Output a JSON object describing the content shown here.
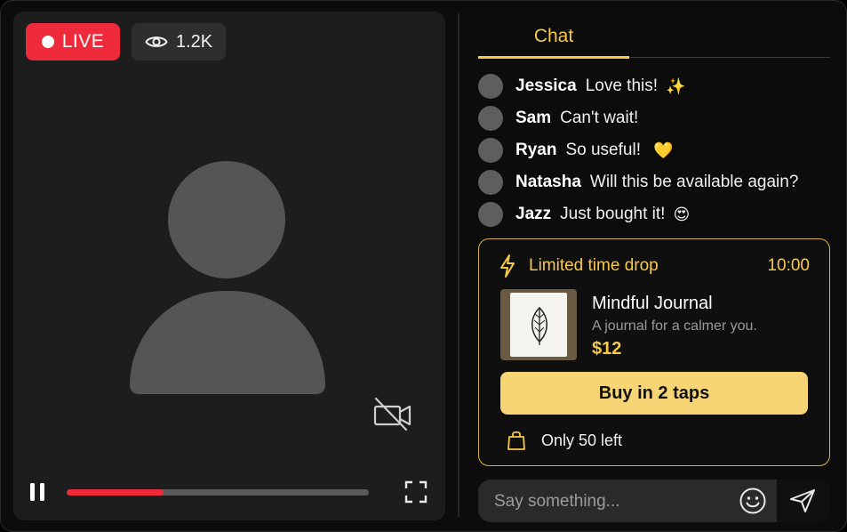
{
  "video": {
    "live_label": "LIVE",
    "viewer_count": "1.2K",
    "playback_progress": 0.32,
    "live_color": "#ee2a3b"
  },
  "chat": {
    "tab_label": "Chat",
    "accent_color": "#f7c948",
    "messages": [
      {
        "user": "Jessica",
        "text": "Love this!",
        "emoji": "✨"
      },
      {
        "user": "Sam",
        "text": "Can't wait!",
        "emoji": ""
      },
      {
        "user": "Ryan",
        "text": "So useful!",
        "emoji": "💛"
      },
      {
        "user": "Natasha",
        "text": "Will this be available again?",
        "emoji": ""
      },
      {
        "user": "Jazz",
        "text": "Just bought it!",
        "emoji": "😍"
      }
    ]
  },
  "drop": {
    "label": "Limited time drop",
    "timer": "10:00",
    "product_name": "Mindful Journal",
    "product_desc": "A journal for a calmer you.",
    "price": "$12",
    "buy_label": "Buy in 2 taps",
    "stock_label": "Only 50 left"
  },
  "composer": {
    "placeholder": "Say something..."
  }
}
